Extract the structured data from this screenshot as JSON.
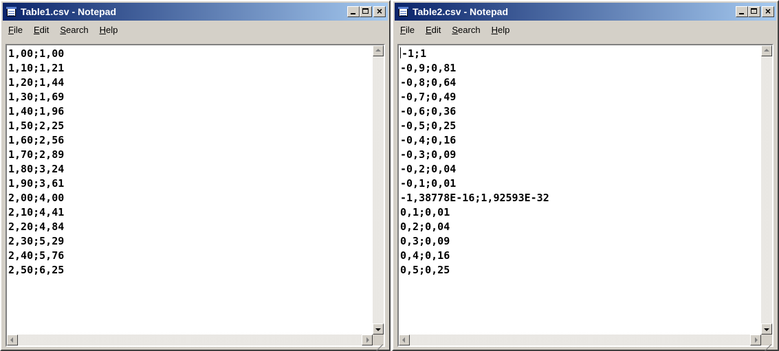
{
  "windows": [
    {
      "title": "Table1.csv - Notepad",
      "menu": [
        "File",
        "Edit",
        "Search",
        "Help"
      ],
      "lines": [
        "1,00;1,00",
        "1,10;1,21",
        "1,20;1,44",
        "1,30;1,69",
        "1,40;1,96",
        "1,50;2,25",
        "1,60;2,56",
        "1,70;2,89",
        "1,80;3,24",
        "1,90;3,61",
        "2,00;4,00",
        "2,10;4,41",
        "2,20;4,84",
        "2,30;5,29",
        "2,40;5,76",
        "2,50;6,25"
      ]
    },
    {
      "title": "Table2.csv - Notepad",
      "menu": [
        "File",
        "Edit",
        "Search",
        "Help"
      ],
      "lines": [
        "-1;1",
        "-0,9;0,81",
        "-0,8;0,64",
        "-0,7;0,49",
        "-0,6;0,36",
        "-0,5;0,25",
        "-0,4;0,16",
        "-0,3;0,09",
        "-0,2;0,04",
        "-0,1;0,01",
        "-1,38778E-16;1,92593E-32",
        "0,1;0,01",
        "0,2;0,04",
        "0,3;0,09",
        "0,4;0,16",
        "0,5;0,25"
      ]
    }
  ],
  "icons": {
    "app": "notepad-icon",
    "minimize": "minimize-icon",
    "maximize": "maximize-icon",
    "close": "close-icon"
  },
  "colors": {
    "titlebar_start": "#0a246a",
    "titlebar_end": "#a6caf0",
    "chrome": "#d4d0c8"
  }
}
